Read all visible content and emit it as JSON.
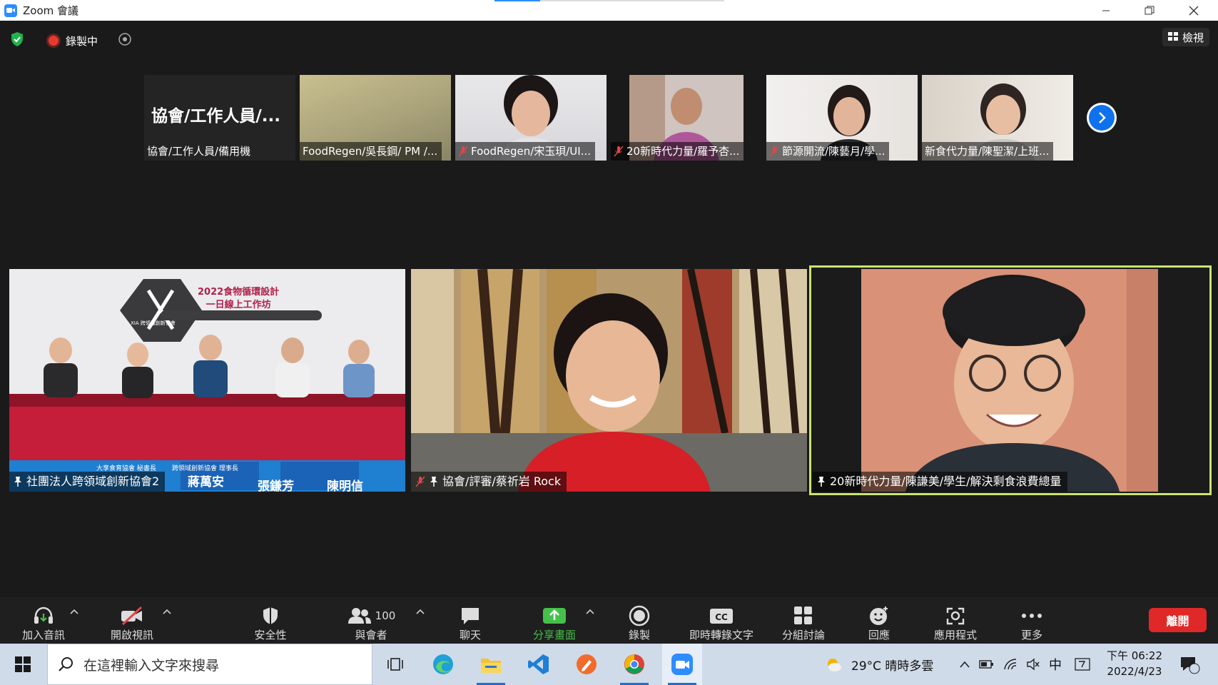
{
  "window": {
    "title": "Zoom 會議"
  },
  "status": {
    "recording_label": "錄製中",
    "view_label": "檢視"
  },
  "thumbnails": [
    {
      "name": "協會/工作人員/備用機",
      "big_label": "協會/工作人員/...",
      "muted": false
    },
    {
      "name": "FoodRegen/吳長鋼/ PM /...",
      "muted": false
    },
    {
      "name": "FoodRegen/宋玉珼/UI...",
      "muted": true
    },
    {
      "name": "20新時代力量/羅予杏...",
      "muted": true
    },
    {
      "name": "節源開流/陳藝月/學...",
      "muted": true
    },
    {
      "name": "新食代力量/陳聖潔/上班...",
      "muted": false
    }
  ],
  "tiles": [
    {
      "name": "社團法人跨領域創新協會2",
      "pinned": true,
      "muted": false,
      "banner": {
        "event_title_line1": "2022食物循環設計",
        "event_title_line2": "一日線上工作坊",
        "org_logo": "XIA 跨領域創新協會",
        "nameplates": [
          "蔣萬安",
          "張鎌芳",
          "陳明信"
        ],
        "roles": [
          "大享食育協會 秘書長",
          "跨領域創新協會 理事長"
        ]
      }
    },
    {
      "name": "協會/評審/蔡祈岩 Rock",
      "pinned": true,
      "muted": true
    },
    {
      "name": "20新時代力量/陳謙美/學生/解決剩食浪費總量",
      "pinned": true,
      "muted": false,
      "active_speaker": true
    }
  ],
  "toolbar": {
    "audio": "加入音訊",
    "video": "開啟視訊",
    "security": "安全性",
    "participants": "與會者",
    "participants_count": "100",
    "chat": "聊天",
    "share": "分享畫面",
    "record": "錄製",
    "captions": "即時轉錄文字",
    "breakout": "分組討論",
    "reactions": "回應",
    "apps": "應用程式",
    "more": "更多",
    "leave": "離開"
  },
  "taskbar": {
    "search_placeholder": "在這裡輸入文字來搜尋",
    "weather": "29°C 晴時多雲",
    "ime": "中",
    "time": "下午 06:22",
    "date": "2022/4/23",
    "notifications": "2"
  },
  "colors": {
    "accent": "#2d8cff",
    "leave": "#e02828",
    "share_green": "#45c14a",
    "active_border": "#c8e56f"
  }
}
